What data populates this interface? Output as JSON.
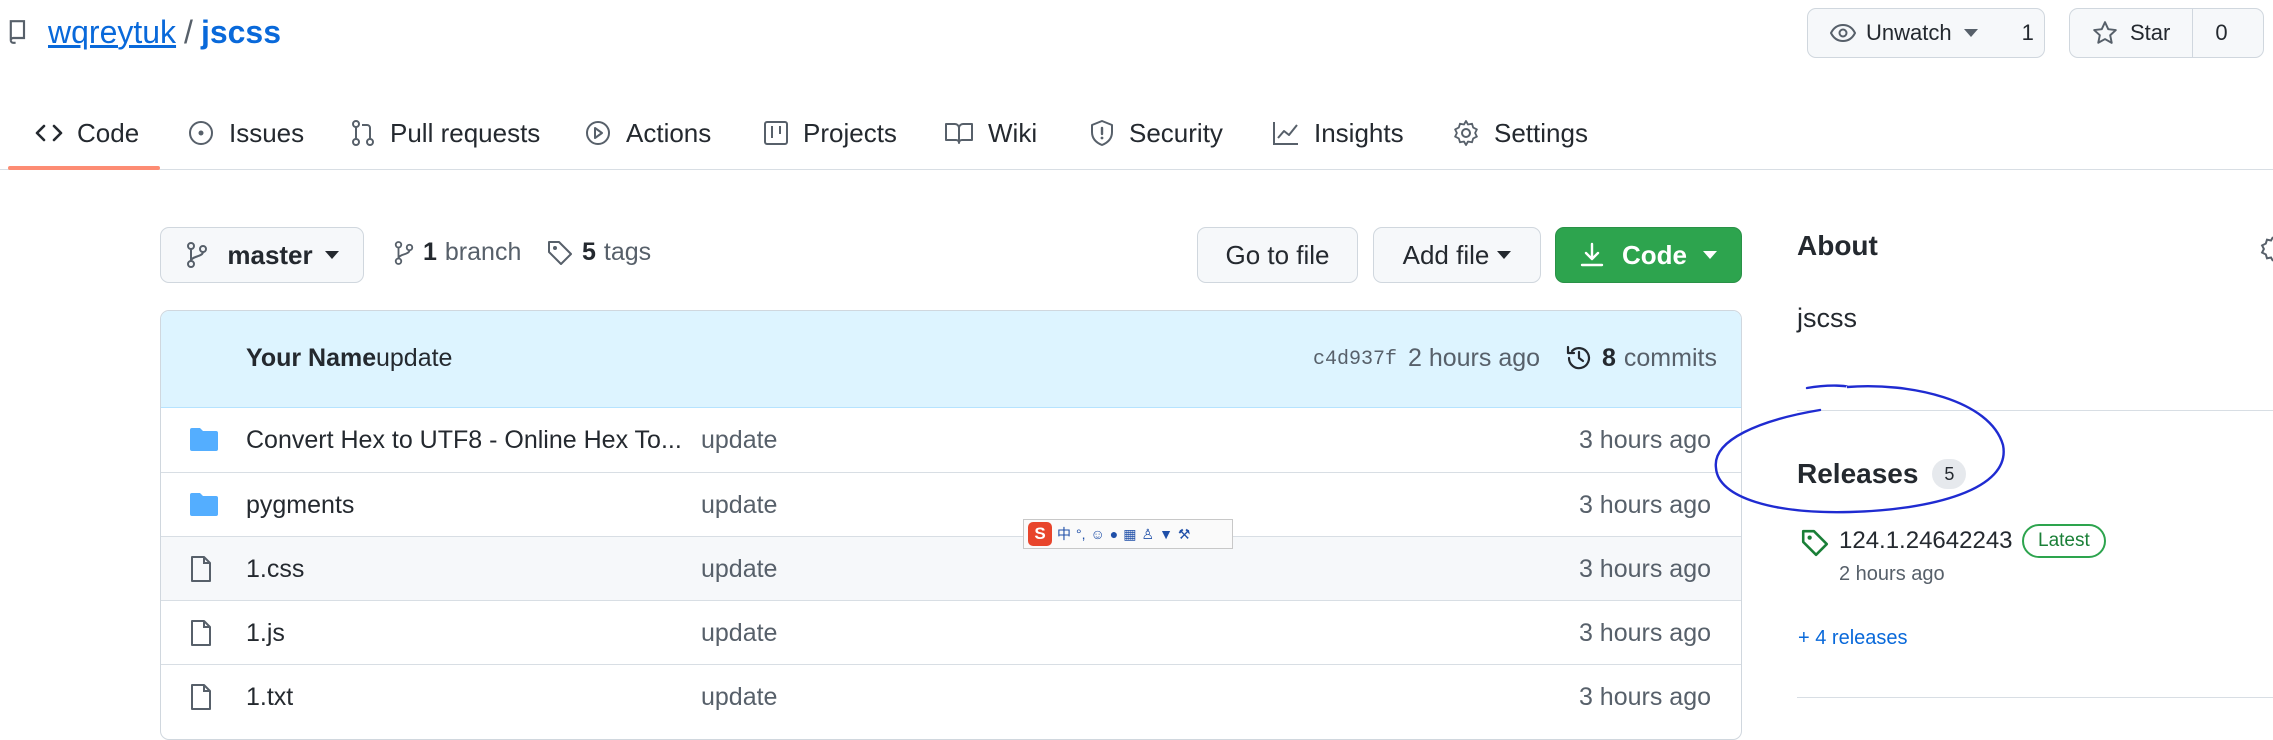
{
  "repo": {
    "owner": "wqreytuk",
    "separator": "/",
    "name": "jscss"
  },
  "header_buttons": {
    "watch": {
      "label": "Unwatch",
      "count": "1"
    },
    "star": {
      "label": "Star",
      "count": "0"
    }
  },
  "tabs": [
    {
      "label": "Code",
      "icon": "code-icon"
    },
    {
      "label": "Issues",
      "icon": "issue-icon"
    },
    {
      "label": "Pull requests",
      "icon": "pull-request-icon"
    },
    {
      "label": "Actions",
      "icon": "play-icon"
    },
    {
      "label": "Projects",
      "icon": "table-icon"
    },
    {
      "label": "Wiki",
      "icon": "book-icon"
    },
    {
      "label": "Security",
      "icon": "shield-icon"
    },
    {
      "label": "Insights",
      "icon": "graph-icon"
    },
    {
      "label": "Settings",
      "icon": "gear-icon"
    }
  ],
  "toolbar": {
    "branch_select": "master",
    "branch_count": "1",
    "branch_label": "branch",
    "tag_count": "5",
    "tag_label": "tags",
    "go_to_file": "Go to file",
    "add_file": "Add file",
    "code": "Code"
  },
  "commit": {
    "author": "Your Name",
    "message": "update",
    "sha": "c4d937f",
    "time": "2 hours ago",
    "count": "8",
    "count_label": "commits"
  },
  "files": [
    {
      "type": "folder",
      "name": "Convert Hex to UTF8 - Online Hex To...",
      "message": "update",
      "age": "3 hours ago"
    },
    {
      "type": "folder",
      "name": "pygments",
      "message": "update",
      "age": "3 hours ago"
    },
    {
      "type": "file",
      "name": "1.css",
      "message": "update",
      "age": "3 hours ago"
    },
    {
      "type": "file",
      "name": "1.js",
      "message": "update",
      "age": "3 hours ago"
    },
    {
      "type": "file",
      "name": "1.txt",
      "message": "update",
      "age": "3 hours ago"
    }
  ],
  "about": {
    "heading": "About",
    "description": "jscss"
  },
  "releases": {
    "heading": "Releases",
    "count": "5",
    "latest_version": "124.1.24642243",
    "latest_badge": "Latest",
    "latest_time": "2 hours ago",
    "more": "+ 4 releases"
  },
  "ime_toolbar": {
    "mode": "中"
  },
  "colors": {
    "accent": "#0969da",
    "green": "#2da44e",
    "tab_underline": "#fd8c73",
    "annotation": "#1f2bd1"
  }
}
